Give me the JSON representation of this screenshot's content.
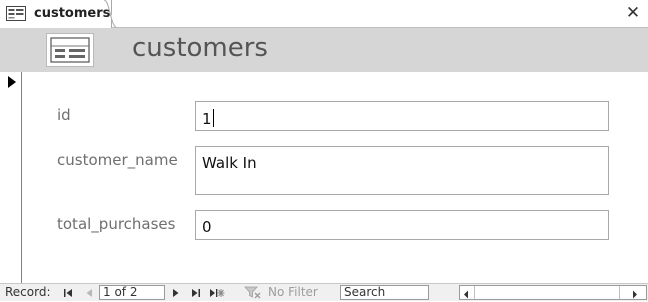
{
  "tab": {
    "label": "customers",
    "icon": "form-icon",
    "close_icon": "close-icon",
    "close_glyph": "✕"
  },
  "header": {
    "title": "customers",
    "icon": "form-icon"
  },
  "fields": [
    {
      "label": "id",
      "value": "1"
    },
    {
      "label": "customer_name",
      "value": "Walk In"
    },
    {
      "label": "total_purchases",
      "value": "0"
    }
  ],
  "navigation": {
    "record_label": "Record:",
    "position": "1 of 2",
    "filter_label": "No Filter",
    "search_placeholder": "Search",
    "icons": [
      "first-record-icon",
      "previous-record-icon",
      "next-record-icon",
      "last-record-icon",
      "new-record-icon",
      "filter-icon"
    ]
  },
  "colors": {
    "header_band": "#d6d6d6",
    "label_text": "#6f6f6f",
    "disabled_text": "#9d9d9d"
  }
}
